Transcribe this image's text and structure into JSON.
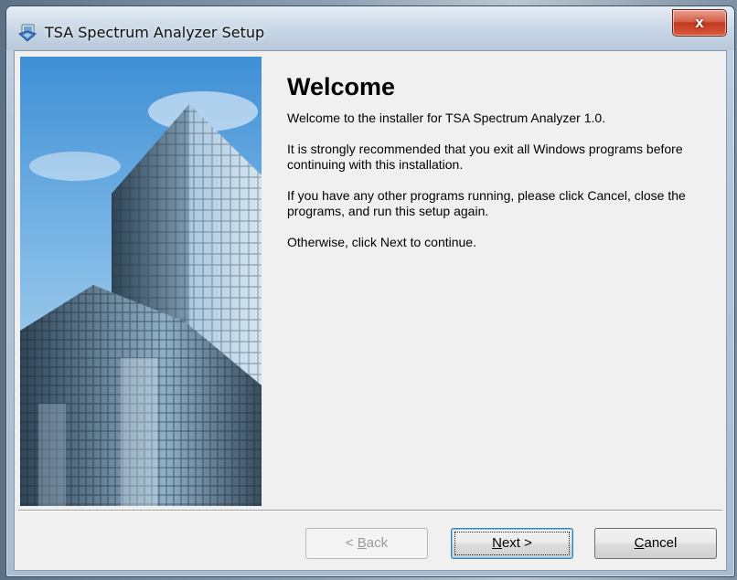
{
  "window": {
    "title": "TSA Spectrum Analyzer Setup",
    "close_glyph": "x"
  },
  "main": {
    "heading": "Welcome",
    "paragraphs": [
      "Welcome to the installer for TSA Spectrum Analyzer 1.0.",
      "It is strongly recommended that you exit all Windows programs before continuing with this installation.",
      "If you have any other programs running, please click Cancel, close the programs, and run this setup again.",
      "Otherwise, click Next to continue."
    ]
  },
  "buttons": {
    "back": {
      "label_pre": "< ",
      "mnemonic": "B",
      "label_post": "ack",
      "enabled": false
    },
    "next": {
      "label_pre": "",
      "mnemonic": "N",
      "label_post": "ext >",
      "enabled": true
    },
    "cancel": {
      "label_pre": "",
      "mnemonic": "C",
      "label_post": "ancel",
      "enabled": true
    }
  },
  "icons": {
    "title": "setup-installer-icon",
    "close": "close-icon",
    "banner": "office-skyscraper-image"
  },
  "colors": {
    "close_button": "#c2391f",
    "client_background": "#f0f0f0",
    "default_button_border": "#3c7fb1"
  }
}
